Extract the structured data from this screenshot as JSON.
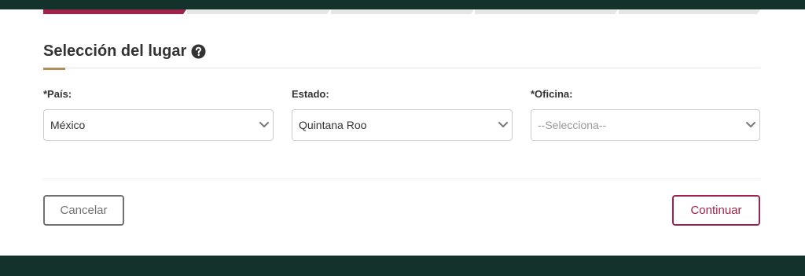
{
  "progress": {
    "steps_total": 5,
    "active_step": 1
  },
  "section": {
    "title": "Selección del lugar",
    "help_icon": "question-circle-icon"
  },
  "form": {
    "pais": {
      "label": "*País:",
      "value": "México"
    },
    "estado": {
      "label": "Estado:",
      "value": "Quintana Roo"
    },
    "oficina": {
      "label": "*Oficina:",
      "placeholder": "--Selecciona--"
    }
  },
  "actions": {
    "cancel_label": "Cancelar",
    "continue_label": "Continuar"
  },
  "colors": {
    "header_bg": "#13322b",
    "progress_active": "#9d2449",
    "accent_gold": "#b38e5d",
    "continue_border": "#9d2449",
    "cancel_border": "#6f7271"
  }
}
